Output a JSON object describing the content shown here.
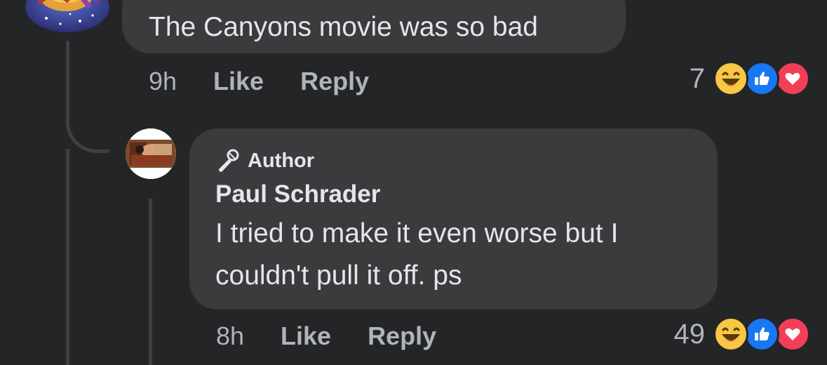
{
  "comments": [
    {
      "text": "The Canyons movie was so bad",
      "time": "9h",
      "like_label": "Like",
      "reply_label": "Reply",
      "reaction_count": "7",
      "reactions": [
        "haha-icon",
        "like-icon",
        "love-icon"
      ]
    },
    {
      "badge": "Author",
      "badge_icon": "microphone-icon",
      "author": "Paul Schrader",
      "text": "I tried to make it even worse but I\ncouldn't pull it off. ps",
      "time": "8h",
      "like_label": "Like",
      "reply_label": "Reply",
      "reaction_count": "49",
      "reactions": [
        "haha-icon",
        "like-icon",
        "love-icon"
      ]
    }
  ],
  "colors": {
    "background": "#242526",
    "bubble": "#3a3b3c",
    "text_primary": "#e4e6eb",
    "text_secondary": "#b0b3b8",
    "haha": "#f7c745",
    "like": "#1877f2",
    "love": "#f33e58"
  }
}
